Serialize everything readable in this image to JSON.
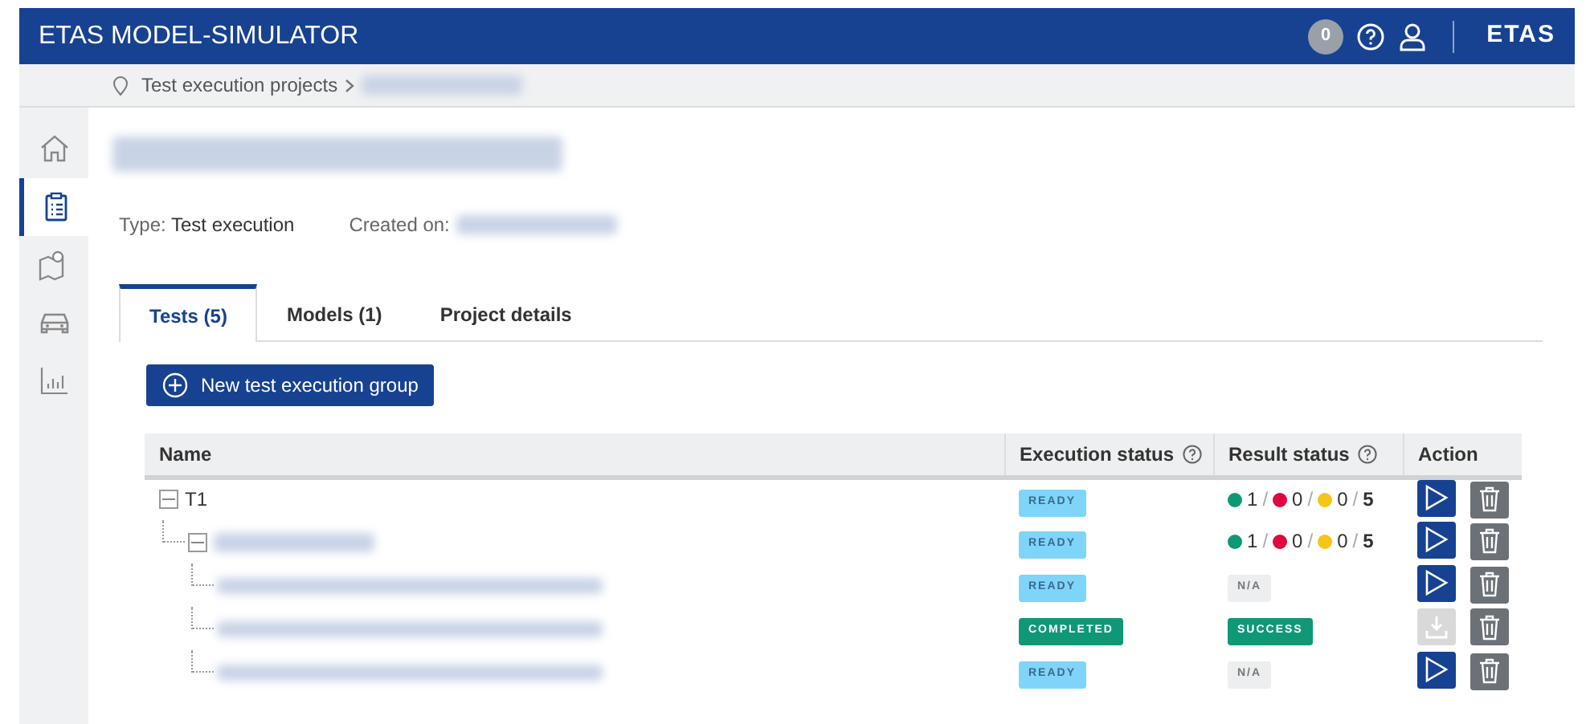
{
  "app": {
    "title": "ETAS MODEL-SIMULATOR",
    "notification_count": "0",
    "brand": "ETAS"
  },
  "breadcrumb": [
    {
      "label": "Test execution projects",
      "blurred": false
    },
    {
      "blurred": true
    }
  ],
  "sidebar": {
    "items": [
      {
        "kind": "home",
        "selected": false
      },
      {
        "kind": "clipboard",
        "selected": true
      },
      {
        "kind": "map",
        "selected": false
      },
      {
        "kind": "car",
        "selected": false
      },
      {
        "kind": "chart",
        "selected": false
      }
    ]
  },
  "project": {
    "title_blurred": true,
    "type_label": "Type:",
    "type_value": "Test execution",
    "created_label": "Created on:",
    "created_blurred": true
  },
  "tabs": [
    {
      "label": "Tests (5)",
      "selected": true
    },
    {
      "label": "Models (1)",
      "selected": false
    },
    {
      "label": "Project details",
      "selected": false
    }
  ],
  "new_button": "New test execution group",
  "table": {
    "columns": [
      {
        "label": "Name",
        "help": false
      },
      {
        "label": "Execution status",
        "help": true
      },
      {
        "label": "Result status",
        "help": true
      },
      {
        "label": "Action",
        "help": false
      }
    ],
    "rows": [
      {
        "name": "T1",
        "blurred": false,
        "expanded": true,
        "execution": {
          "kind": "ready",
          "text": "READY"
        },
        "result": {
          "kind": "counts",
          "passed": "1",
          "failed": "0",
          "warned": "0",
          "total": "5",
          "separator": "/"
        },
        "action": {
          "kind": "run",
          "disabled": false
        },
        "children": [
          {
            "blurred": true,
            "expanded": true,
            "execution": {
              "kind": "ready",
              "text": "READY"
            },
            "result": {
              "kind": "counts",
              "passed": "1",
              "failed": "0",
              "warned": "0",
              "total": "5",
              "separator": "/"
            },
            "action": {
              "kind": "run",
              "disabled": false
            },
            "children": [
              {
                "blurred": true,
                "execution": {
                  "kind": "ready",
                  "text": "READY"
                },
                "result": {
                  "kind": "na",
                  "text": "N/A"
                },
                "action": {
                  "kind": "run",
                  "disabled": false
                }
              },
              {
                "blurred": true,
                "execution": {
                  "kind": "completed",
                  "text": "COMPLETED"
                },
                "result": {
                  "kind": "success",
                  "text": "SUCCESS"
                },
                "action": {
                  "kind": "download",
                  "disabled": true
                }
              },
              {
                "blurred": true,
                "execution": {
                  "kind": "ready",
                  "text": "READY"
                },
                "result": {
                  "kind": "na",
                  "text": "N/A"
                },
                "action": {
                  "kind": "run",
                  "disabled": false
                }
              }
            ]
          }
        ]
      }
    ]
  }
}
